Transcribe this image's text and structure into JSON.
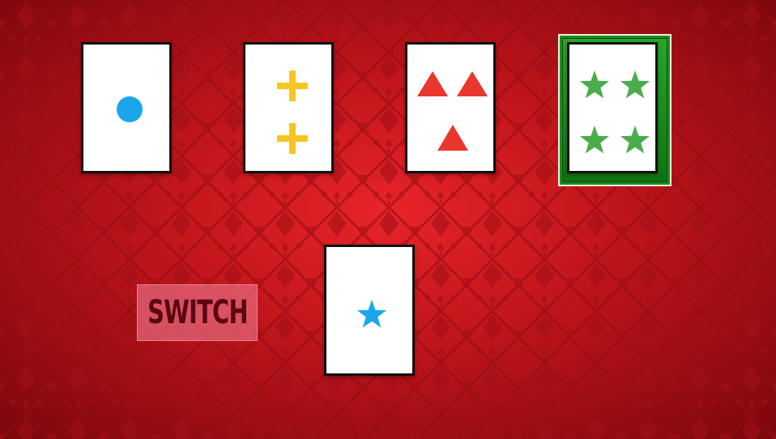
{
  "game": {
    "switch_button_label": "SWITCH",
    "selected_choice_index": 4
  },
  "colors": {
    "felt_red": "#c3161c",
    "felt_pattern": "#8f0c12",
    "card_face": "#ffffff",
    "card_border": "#111111",
    "selection_green": "#1f8a1f",
    "switch_button_bg": "#ee788e",
    "switch_text": "#5a0712"
  },
  "choice_cards": [
    {
      "count": 1,
      "shape": "circle",
      "color": "#1ba6ec"
    },
    {
      "count": 2,
      "shape": "cross",
      "color": "#f6c51f"
    },
    {
      "count": 3,
      "shape": "triangle",
      "color": "#e9372e"
    },
    {
      "count": 4,
      "shape": "star",
      "color": "#4aac4a"
    }
  ],
  "target_card": {
    "count": 1,
    "shape": "star",
    "color": "#1ba6ec"
  }
}
